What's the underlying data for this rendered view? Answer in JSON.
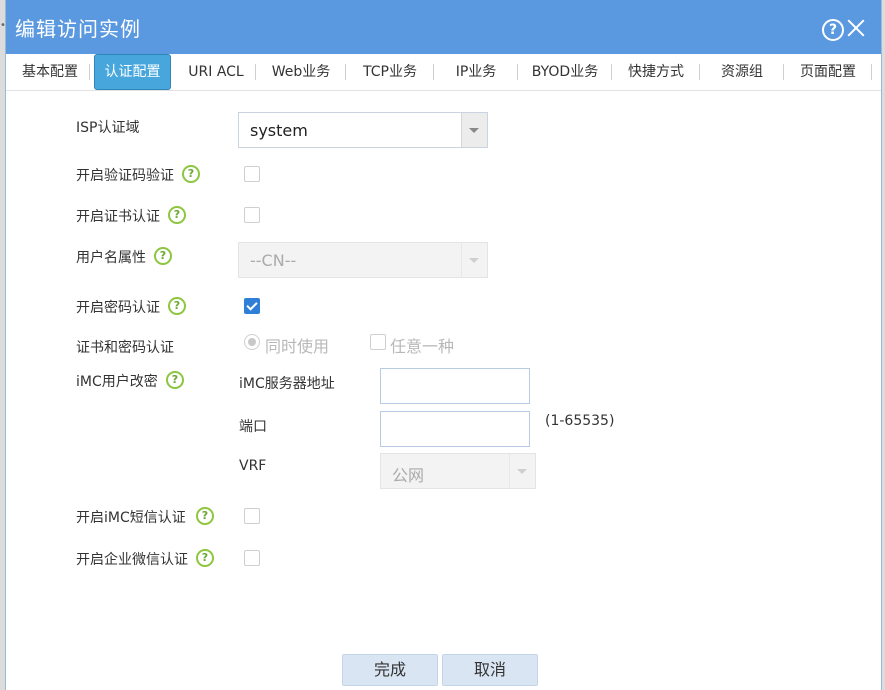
{
  "dialog": {
    "title": "编辑访问实例"
  },
  "tabs": [
    {
      "label": "基本配置",
      "active": false
    },
    {
      "label": "认证配置",
      "active": true
    },
    {
      "label": "URI ACL",
      "active": false
    },
    {
      "label": "Web业务",
      "active": false
    },
    {
      "label": "TCP业务",
      "active": false
    },
    {
      "label": "IP业务",
      "active": false
    },
    {
      "label": "BYOD业务",
      "active": false
    },
    {
      "label": "快捷方式",
      "active": false
    },
    {
      "label": "资源组",
      "active": false
    },
    {
      "label": "页面配置",
      "active": false
    }
  ],
  "form": {
    "isp_label": "ISP认证域",
    "isp_value": "system",
    "captcha_label": "开启验证码验证",
    "captcha_checked": false,
    "cert_label": "开启证书认证",
    "cert_checked": false,
    "username_attr_label": "用户名属性",
    "username_attr_value": "--CN--",
    "password_label": "开启密码认证",
    "password_checked": true,
    "cert_pwd_label": "证书和密码认证",
    "cert_pwd_options": [
      "同时使用",
      "任意一种"
    ],
    "imc_change_label": "iMC用户改密",
    "imc_server_label": "iMC服务器地址",
    "imc_server_value": "",
    "port_label": "端口",
    "port_value": "",
    "port_hint": "(1-65535)",
    "vrf_label": "VRF",
    "vrf_value": "公网",
    "imc_sms_label": "开启iMC短信认证",
    "imc_sms_checked": false,
    "wechat_label": "开启企业微信认证",
    "wechat_checked": false
  },
  "buttons": {
    "ok": "完成",
    "cancel": "取消"
  },
  "icons": {
    "help": "help-circle-icon",
    "close": "close-icon",
    "field_help": "question-circle-icon",
    "accent_color": "#5a99e0",
    "help_green": "#8dc63f"
  }
}
